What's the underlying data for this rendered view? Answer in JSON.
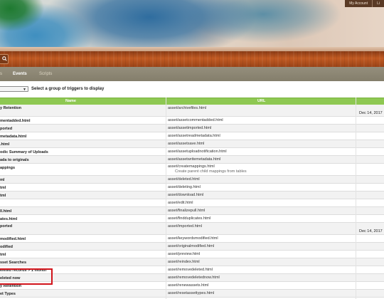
{
  "header": {
    "user_menu": [
      "My Account",
      "Li"
    ]
  },
  "nav": {
    "tabs": [
      {
        "label": "s",
        "state": "idle"
      },
      {
        "label": "Events",
        "state": "active"
      },
      {
        "label": "Scripts",
        "state": "idle"
      }
    ]
  },
  "filter": {
    "selected_value": "",
    "label": "Select a group of triggers to display"
  },
  "table": {
    "columns": [
      "Name",
      "URL"
    ],
    "rows": [
      {
        "name": "y Retention",
        "url": "asset/archivefiles.html",
        "date": "Dec 14, 2017"
      },
      {
        "name": "mentadded.html",
        "url": "asset/assetcommentadded.html"
      },
      {
        "name": "ported",
        "url": "asset/assetimported.html"
      },
      {
        "name": "metadata.html",
        "url": "asset/assetreadmetadata.html"
      },
      {
        "name": ".html",
        "url": "asset/assetsave.html"
      },
      {
        "name": "odic Summary of Uploads",
        "url": "asset/assetuploadnotification.html"
      },
      {
        "name": "ada to originals",
        "url": "asset/assetwritemetadata.html"
      },
      {
        "name": "appings",
        "url": "asset/createmappings.html",
        "description": "Create parent child mappings from tables"
      },
      {
        "name": "ml",
        "url": "asset/deleted.html"
      },
      {
        "name": "tml",
        "url": "asset/deleting.html"
      },
      {
        "name": "tml",
        "url": "asset/download.html"
      },
      {
        "name": "",
        "url": "asset/edit.html"
      },
      {
        "name": "ll.html",
        "url": "asset/finalizepull.html"
      },
      {
        "name": "ates.html",
        "url": "asset/findduplicates.html"
      },
      {
        "name": "ported",
        "url": "asset/imported.html",
        "date": "Dec 14, 2017"
      },
      {
        "name": "modified.html",
        "url": "asset/keywordsmodified.html"
      },
      {
        "name": "odified",
        "url": "asset/originalmodified.html"
      },
      {
        "name": "tml",
        "url": "asset/preview.html"
      },
      {
        "name": "sset Searches",
        "url": "asset/reindex.html"
      },
      {
        "name": "eleted records > 1 month",
        "url": "asset/removedeleted.html"
      },
      {
        "name": "eleted now",
        "url": "asset/removedeletednow.html"
      },
      {
        "name": "y Retention",
        "url": "asset/renewassets.html"
      },
      {
        "name": "et Types",
        "url": "asset/resetassettypes.html"
      }
    ]
  },
  "colors": {
    "table_header": "#8ec852",
    "tab_bar": "#8a846f",
    "wood_bar": "#b4521f",
    "highlight": "#d1141b"
  }
}
